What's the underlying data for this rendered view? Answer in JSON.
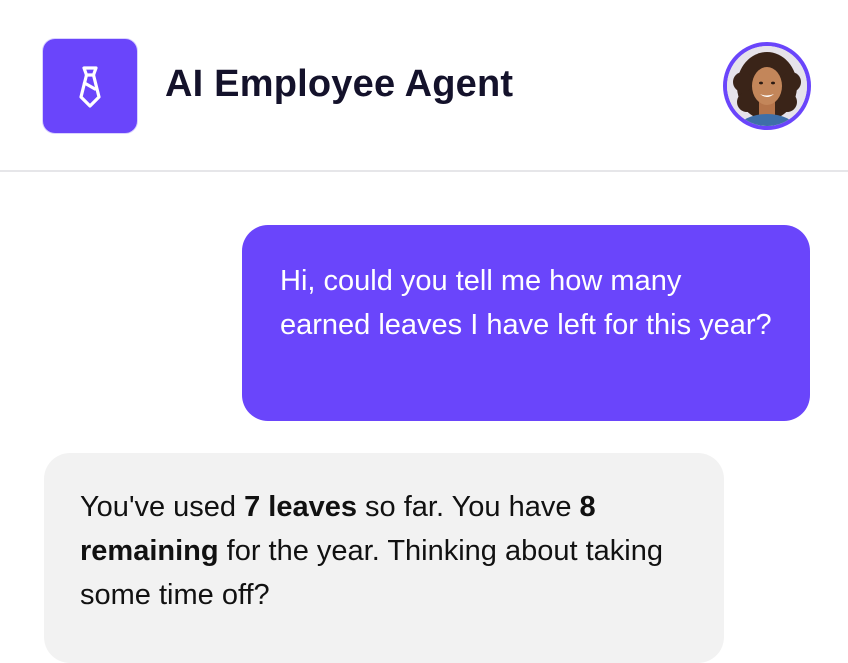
{
  "header": {
    "logo_icon": "necktie-icon",
    "title": "AI Employee Agent",
    "avatar_icon": "user-avatar",
    "accent_color": "#6a45fb"
  },
  "conversation": {
    "user_message": "Hi, could you tell me how many earned leaves I have left for this year?",
    "bot_reply": {
      "part1": "You've used ",
      "bold1": "7 leaves",
      "part2": " so far. You have ",
      "bold2": "8 remaining",
      "part3": " for the year. Thinking about taking some time off?"
    }
  }
}
